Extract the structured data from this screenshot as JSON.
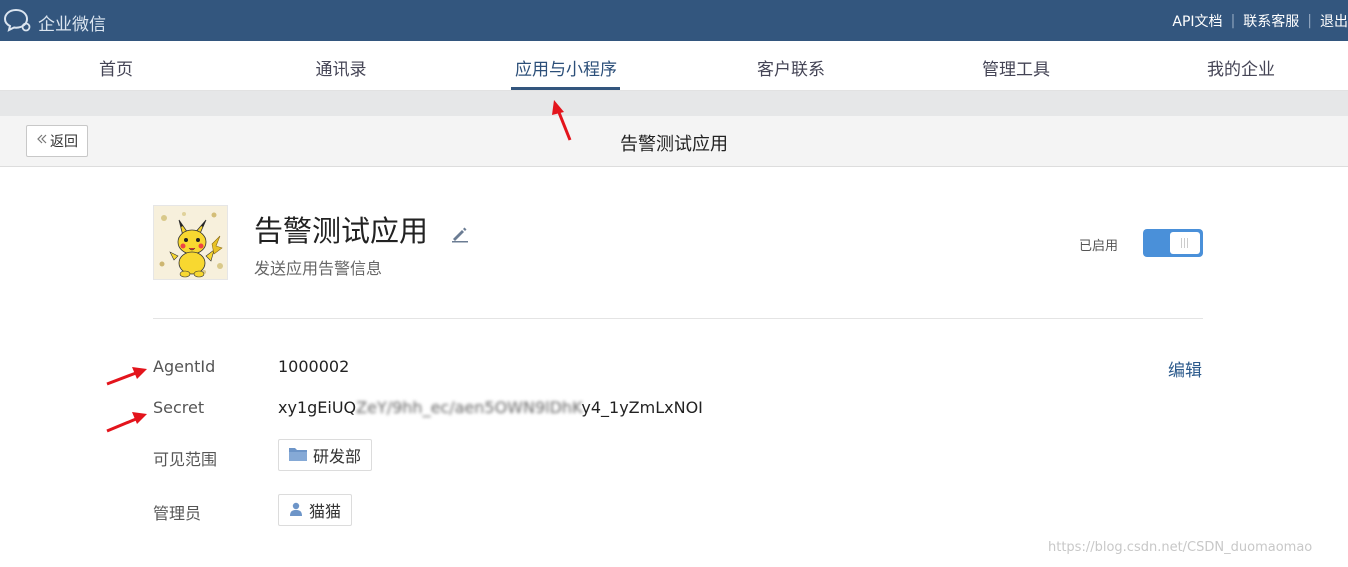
{
  "topbar": {
    "logo_text": "企业微信",
    "links": [
      "API文档",
      "联系客服",
      "退出"
    ]
  },
  "nav": {
    "items": [
      "首页",
      "通讯录",
      "应用与小程序",
      "客户联系",
      "管理工具",
      "我的企业"
    ],
    "active_index": 2
  },
  "subheader": {
    "back_label": "返回",
    "title": "告警测试应用"
  },
  "app": {
    "name": "告警测试应用",
    "description": "发送应用告警信息",
    "status_label": "已启用",
    "enabled": true
  },
  "fields": {
    "agentid_label": "AgentId",
    "agentid_value": "1000002",
    "secret_label": "Secret",
    "secret_prefix": "xy1gEiUQ",
    "secret_obscured": "ZeY/9hh_ec/aen5OWN9lDhK",
    "secret_suffix": "y4_1yZmLxNOI",
    "scope_label": "可见范围",
    "scope_value": "研发部",
    "admin_label": "管理员",
    "admin_value": "猫猫",
    "edit_label": "编辑"
  },
  "watermark": "https://blog.csdn.net/CSDN_duomaomao",
  "colors": {
    "topbar": "#33567e",
    "toggle": "#4a90d9",
    "annotation_arrow": "#e3141c"
  }
}
